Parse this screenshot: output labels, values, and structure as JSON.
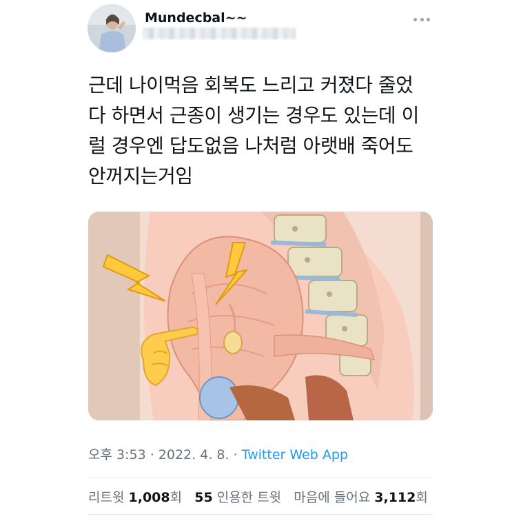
{
  "user": {
    "display_name": "Mundecbal~~",
    "avatar_icon": "profile-photo"
  },
  "tweet": {
    "lines": [
      "근데 나이먹음 회복도 느리고 커졌다 줄었",
      "다 하면서 근종이 생기는 경우도 있는데 이",
      "럴 경우엔 답도없음 나처럼 아랫배 죽어도",
      "안꺼지는거임"
    ]
  },
  "media": {
    "icons": [
      "lightning-bolt-icon",
      "lightning-bolt-icon",
      "pointing-hand-icon"
    ],
    "colors": {
      "background": "#ead5c6",
      "uterus": "#f2b9a4",
      "bolt": "#ffc83d"
    }
  },
  "meta": {
    "time": "오후 3:53",
    "sep1": " · ",
    "date": "2022. 4. 8.",
    "sep2": " · ",
    "source": "Twitter Web App"
  },
  "stats": {
    "retweets_label": "리트윗",
    "retweets_value": "1,008",
    "retweets_unit": "회",
    "quotes_value": "55",
    "quotes_label": "인용한 트윗",
    "likes_label": "마음에 들어요",
    "likes_value": "3,112",
    "likes_unit": "회"
  }
}
